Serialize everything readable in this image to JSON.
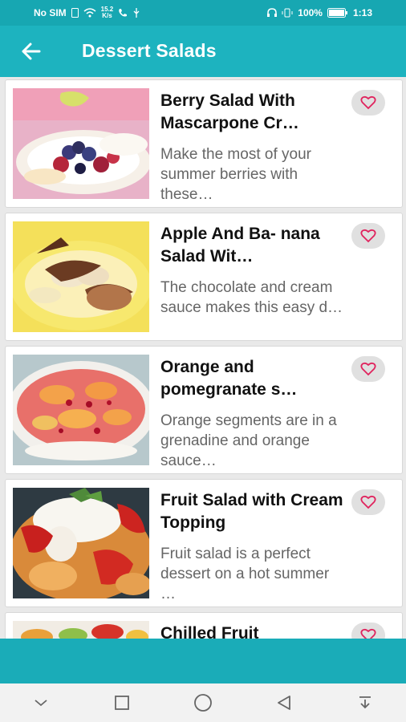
{
  "status_bar": {
    "carrier": "No SIM",
    "speed_top": "15.2",
    "speed_bottom": "K/s",
    "battery": "100%",
    "time": "1:13"
  },
  "app_bar": {
    "title": "Dessert Salads",
    "back_icon": "arrow-left-icon"
  },
  "recipes": [
    {
      "title": "Berry Salad With Mascarpone Cr…",
      "description": "Make the most of your summer berries with these…"
    },
    {
      "title": "Apple And Ba- nana Salad Wit…",
      "description": "The chocolate and cream sauce makes this easy d…"
    },
    {
      "title": "Orange and pomegranate s…",
      "description": "Orange segments are in a grenadine and orange sauce…"
    },
    {
      "title": "Fruit Salad with Cream Topping",
      "description": "Fruit salad is a perfect dessert on a hot summer …"
    },
    {
      "title": "Chilled Fruit",
      "description": ""
    }
  ],
  "colors": {
    "primary": "#1db3bf",
    "status": "#17a7b2",
    "heart": "#e0245e"
  },
  "nav": [
    "chevron-down-icon",
    "square-icon",
    "circle-icon",
    "triangle-back-icon",
    "download-icon"
  ]
}
